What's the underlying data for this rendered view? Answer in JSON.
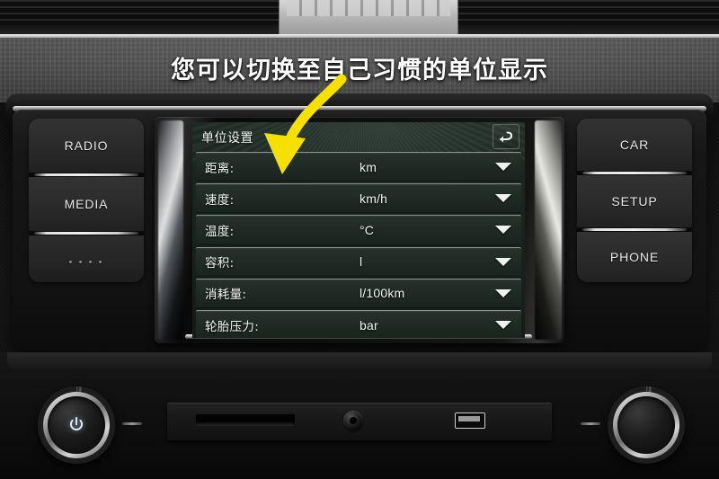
{
  "annotation": {
    "text": "您可以切换至自己习惯的单位显示",
    "arrow_color": "#f5e000",
    "arrow_name": "curved-down-arrow"
  },
  "head_unit": {
    "left_buttons": [
      {
        "label": "RADIO",
        "name": "radio-button"
      },
      {
        "label": "MEDIA",
        "name": "media-button"
      }
    ],
    "right_buttons": [
      {
        "label": "CAR",
        "name": "car-button"
      },
      {
        "label": "SETUP",
        "name": "setup-button"
      },
      {
        "label": "PHONE",
        "name": "phone-button"
      }
    ]
  },
  "screen": {
    "title": "单位设置",
    "back_icon": "back-arrow-icon",
    "background_color": "#1d2a23",
    "text_color": "#f2f5f2",
    "rows": [
      {
        "label": "距离:",
        "value": "km"
      },
      {
        "label": "速度:",
        "value": "km/h"
      },
      {
        "label": "温度:",
        "value": "°C"
      },
      {
        "label": "容积:",
        "value": "l"
      },
      {
        "label": "消耗量:",
        "value": "l/100km"
      },
      {
        "label": "轮胎压力:",
        "value": "bar"
      }
    ]
  },
  "console": {
    "power_knob": "power-volume-knob",
    "tuning_knob": "tuning-knob",
    "sd_slot": "sd-card-slot",
    "aux_jack": "aux-input-jack",
    "usb_port": "usb-port"
  }
}
